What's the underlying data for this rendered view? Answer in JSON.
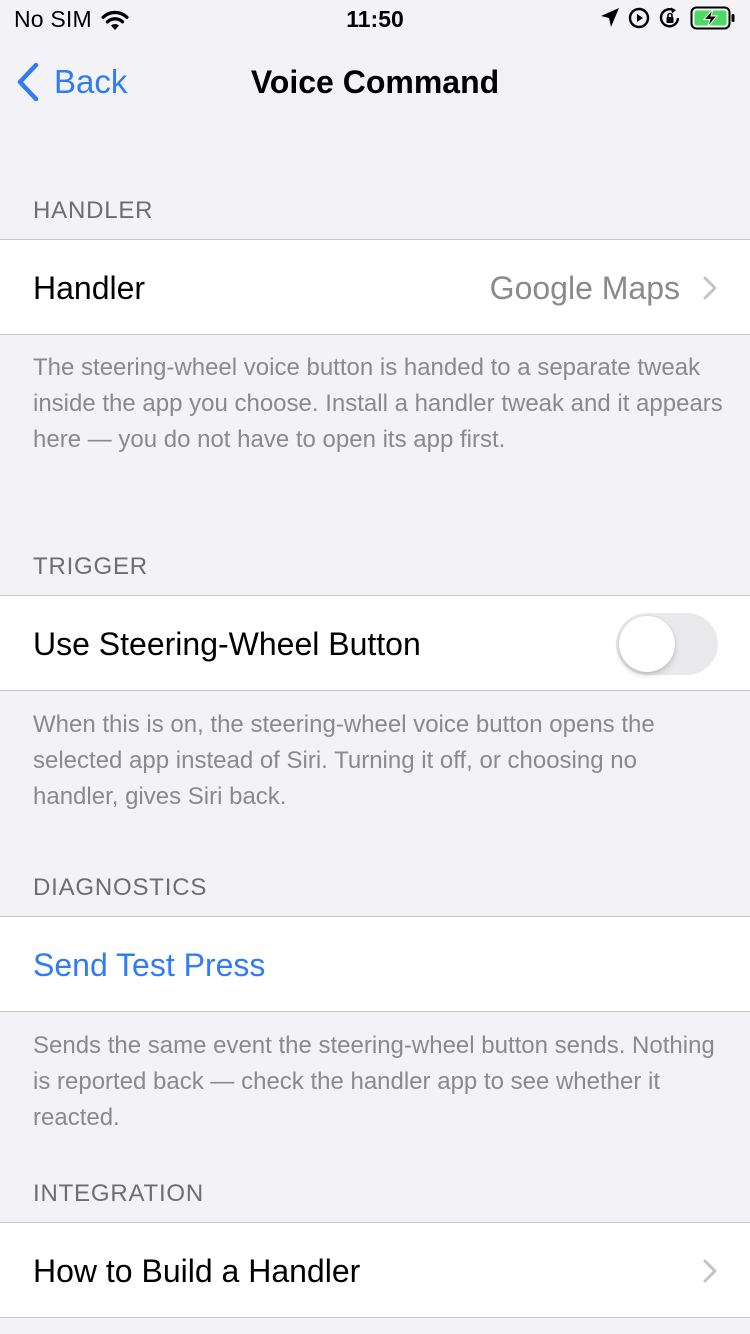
{
  "status_bar": {
    "carrier": "No SIM",
    "time": "11:50"
  },
  "nav": {
    "back_label": "Back",
    "title": "Voice Command"
  },
  "sections": {
    "handler": {
      "header": "HANDLER",
      "row_label": "Handler",
      "row_value": "Google Maps",
      "footer": "The steering-wheel voice button is handed to a separate tweak inside the app you choose. Install a handler tweak and it appears here — you do not have to open its app first."
    },
    "trigger": {
      "header": "TRIGGER",
      "row_label": "Use Steering-Wheel Button",
      "toggle_on": false,
      "footer": "When this is on, the steering-wheel voice button opens the selected app instead of Siri. Turning it off, or choosing no handler, gives Siri back."
    },
    "diagnostics": {
      "header": "DIAGNOSTICS",
      "row_label": "Send Test Press",
      "footer": "Sends the same event the steering-wheel button sends. Nothing is reported back — check the handler app to see whether it reacted."
    },
    "integration": {
      "header": "INTEGRATION",
      "row_label": "How to Build a Handler"
    }
  },
  "colors": {
    "accent": "#2f7cf6",
    "background": "#f2f2f7",
    "secondary_text": "#8a8a8e",
    "battery_fill": "#4cd964"
  }
}
